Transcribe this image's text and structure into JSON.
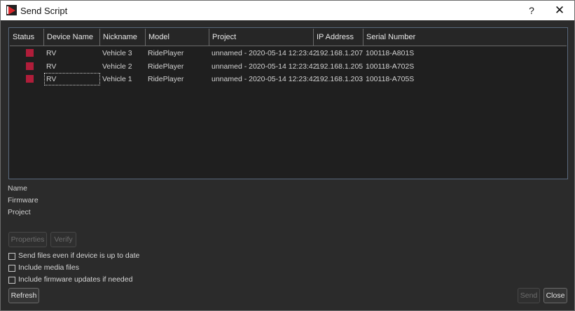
{
  "window": {
    "title": "Send Script",
    "help_label": "?",
    "close_label": "✕"
  },
  "table": {
    "headers": [
      "Status",
      "Device Name",
      "Nickname",
      "Model",
      "Project",
      "IP Address",
      "Serial Number"
    ],
    "rows": [
      {
        "device_name": "RV",
        "nickname": "Vehicle 3",
        "model": "RidePlayer",
        "project": "unnamed - 2020-05-14 12:23:42",
        "ip": "192.168.1.207",
        "serial": "100118-A801S"
      },
      {
        "device_name": "RV",
        "nickname": "Vehicle 2",
        "model": "RidePlayer",
        "project": "unnamed - 2020-05-14 12:23:42",
        "ip": "192.168.1.205",
        "serial": "100118-A702S"
      },
      {
        "device_name": "RV",
        "nickname": "Vehicle 1",
        "model": "RidePlayer",
        "project": "unnamed - 2020-05-14 12:23:42",
        "ip": "192.168.1.203",
        "serial": "100118-A705S"
      }
    ],
    "status_color": "#b01d3a"
  },
  "info": {
    "name_label": "Name",
    "firmware_label": "Firmware",
    "project_label": "Project"
  },
  "buttons": {
    "properties": "Properties",
    "verify": "Verify",
    "refresh": "Refresh",
    "send": "Send",
    "close": "Close"
  },
  "options": [
    {
      "label": "Send files even if device is up to date",
      "checked": false
    },
    {
      "label": "Include media files",
      "checked": false
    },
    {
      "label": "Include firmware updates if needed",
      "checked": false
    }
  ]
}
